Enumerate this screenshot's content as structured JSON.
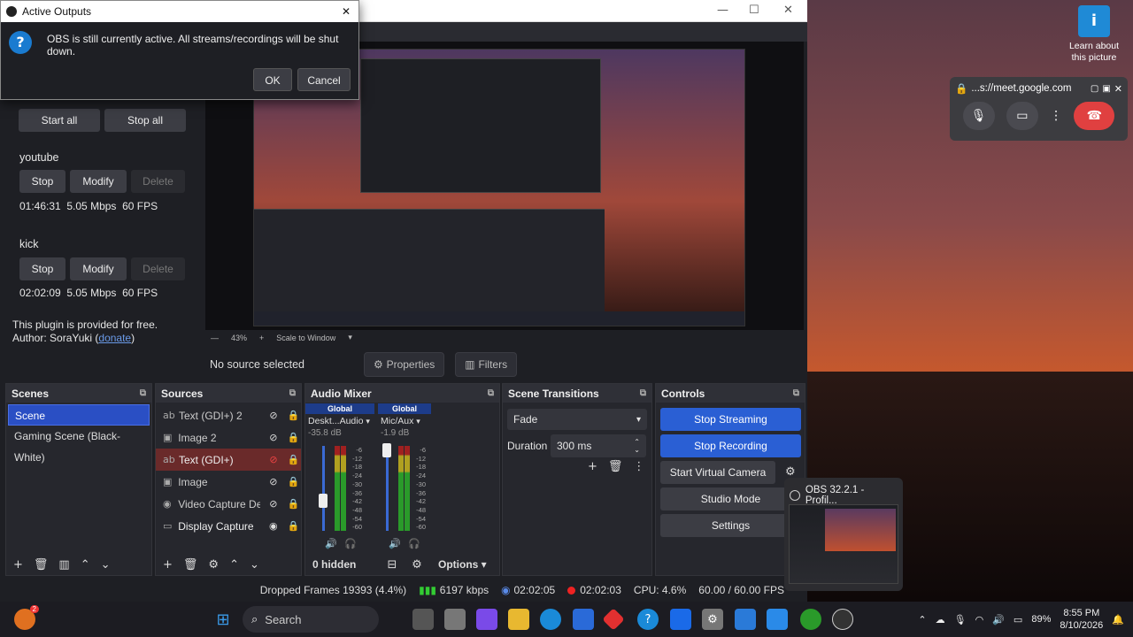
{
  "dialog": {
    "title": "Active Outputs",
    "message": "OBS is still currently active. All streams/recordings will be shut down.",
    "ok": "OK",
    "cancel": "Cancel",
    "close": "✕"
  },
  "plugin": {
    "start_all": "Start all",
    "stop_all": "Stop all",
    "outputs": [
      {
        "name": "youtube",
        "stop": "Stop",
        "modify": "Modify",
        "delete": "Delete",
        "stats": "01:46:31  5.05 Mbps  60 FPS"
      },
      {
        "name": "kick",
        "stop": "Stop",
        "modify": "Modify",
        "delete": "Delete",
        "stats": "02:02:09  5.05 Mbps  60 FPS"
      }
    ],
    "free_text": "This plugin is provided for free.",
    "author_prefix": "Author: SoraYuki (",
    "donate": "donate",
    "author_suffix": ")"
  },
  "preview": {
    "zoom": "43%",
    "scale": "Scale to Window"
  },
  "source_bar": {
    "no_source": "No source selected",
    "properties": "Properties",
    "filters": "Filters"
  },
  "scenes": {
    "title": "Scenes",
    "items": [
      "Scene",
      "Gaming Scene (Black-White)"
    ]
  },
  "sources": {
    "title": "Sources",
    "items": [
      "Text (GDI+) 2",
      "Image 2",
      "Text (GDI+)",
      "Image",
      "Video Capture De",
      "Display Capture"
    ]
  },
  "mixer": {
    "title": "Audio Mixer",
    "channels": [
      {
        "global": "Global",
        "name": "Deskt...Audio",
        "db": "-35.8 dB",
        "level": 0.35
      },
      {
        "global": "Global",
        "name": "Mic/Aux",
        "db": "-1.9 dB",
        "level": 0.95
      }
    ],
    "ticks": [
      "-6",
      "-12",
      "-18",
      "-24",
      "-30",
      "-36",
      "-42",
      "-48",
      "-54",
      "-60"
    ],
    "hidden": "0 hidden",
    "options": "Options"
  },
  "transitions": {
    "title": "Scene Transitions",
    "type": "Fade",
    "duration_label": "Duration",
    "duration": "300 ms"
  },
  "controls": {
    "title": "Controls",
    "stop_streaming": "Stop Streaming",
    "stop_recording": "Stop Recording",
    "virtual_camera": "Start Virtual Camera",
    "studio_mode": "Studio Mode",
    "settings": "Settings"
  },
  "status": {
    "dropped": "Dropped Frames 19393 (4.4%)",
    "kbps": "6197 kbps",
    "stream_time": "02:02:05",
    "rec_time": "02:02:03",
    "cpu": "CPU: 4.6%",
    "fps": "60.00 / 60.00 FPS"
  },
  "meet": {
    "url": "...s://meet.google.com"
  },
  "desktop_icon": {
    "label1": "Learn about",
    "label2": "this picture"
  },
  "task_preview": {
    "title": "OBS 32.2.1 - Profil..."
  },
  "taskbar": {
    "search": "Search",
    "notification_count": "2",
    "battery": "89%",
    "time": "8:55 PM",
    "date": "8/10/2026"
  },
  "colors": {
    "accent_blue": "#2a5fd4",
    "selected_source": "#6a2a2a",
    "end_call": "#e04040"
  }
}
